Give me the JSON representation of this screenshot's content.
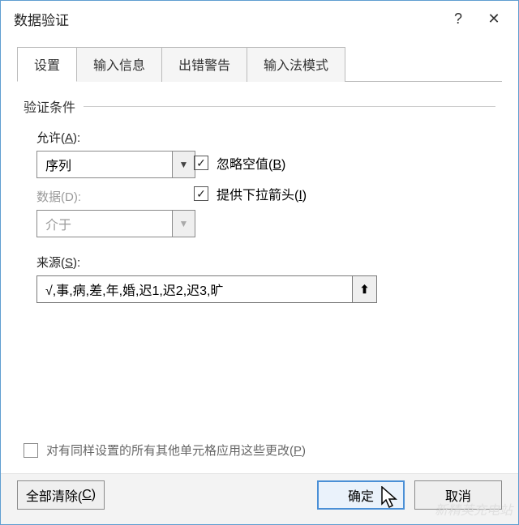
{
  "title": "数据验证",
  "tabs": {
    "settings": "设置",
    "input_message": "输入信息",
    "error_alert": "出错警告",
    "ime_mode": "输入法模式"
  },
  "criteria": {
    "legend": "验证条件",
    "allow_label_prefix": "允许(",
    "allow_label_key": "A",
    "allow_label_suffix": "):",
    "allow_value": "序列",
    "data_label_prefix": "数据(",
    "data_label_key": "D",
    "data_label_suffix": "):",
    "data_value": "介于",
    "ignore_blank_prefix": "忽略空值(",
    "ignore_blank_key": "B",
    "ignore_blank_suffix": ")",
    "in_cell_dropdown_prefix": "提供下拉箭头(",
    "in_cell_dropdown_key": "I",
    "in_cell_dropdown_suffix": ")",
    "source_label_prefix": "来源(",
    "source_label_key": "S",
    "source_label_suffix": "):",
    "source_value": "√,事,病,差,年,婚,迟1,迟2,迟3,旷"
  },
  "apply_same_prefix": "对有同样设置的所有其他单元格应用这些更改(",
  "apply_same_key": "P",
  "apply_same_suffix": ")",
  "buttons": {
    "clear_all_prefix": "全部清除(",
    "clear_all_key": "C",
    "clear_all_suffix": ")",
    "ok": "确定",
    "cancel": "取消"
  },
  "watermark": "新精英充电站"
}
